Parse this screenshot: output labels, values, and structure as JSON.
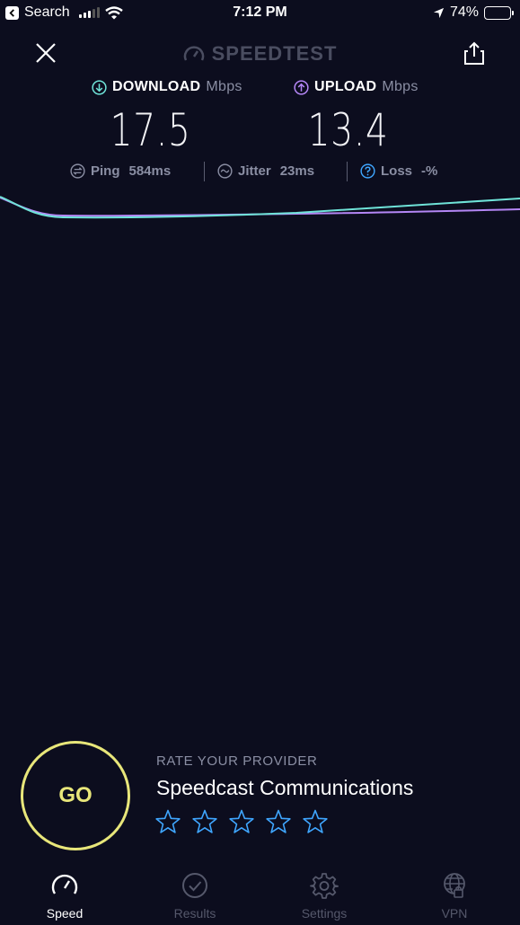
{
  "status_bar": {
    "back_label": "Search",
    "time": "7:12 PM",
    "battery": "74%"
  },
  "header": {
    "brand": "SPEEDTEST"
  },
  "download": {
    "label": "DOWNLOAD",
    "unit": "Mbps",
    "value": "17.5",
    "color": "#6fe3d8"
  },
  "upload": {
    "label": "UPLOAD",
    "unit": "Mbps",
    "value": "13.4",
    "color": "#b486f5"
  },
  "stats": {
    "ping_label": "Ping",
    "ping_value": "584",
    "ping_unit": "ms",
    "jitter_label": "Jitter",
    "jitter_value": "23",
    "jitter_unit": "ms",
    "loss_label": "Loss",
    "loss_value": "-%"
  },
  "go_button": "GO",
  "rate": {
    "title": "RATE YOUR PROVIDER",
    "provider": "Speedcast Communications",
    "stars_total": 5,
    "stars_filled": 0,
    "star_color": "#3fa6ff"
  },
  "tabs": [
    {
      "label": "Speed",
      "icon": "speedometer-icon",
      "active": true
    },
    {
      "label": "Results",
      "icon": "check-circle-icon",
      "active": false
    },
    {
      "label": "Settings",
      "icon": "gear-icon",
      "active": false
    },
    {
      "label": "VPN",
      "icon": "globe-lock-icon",
      "active": false
    }
  ]
}
